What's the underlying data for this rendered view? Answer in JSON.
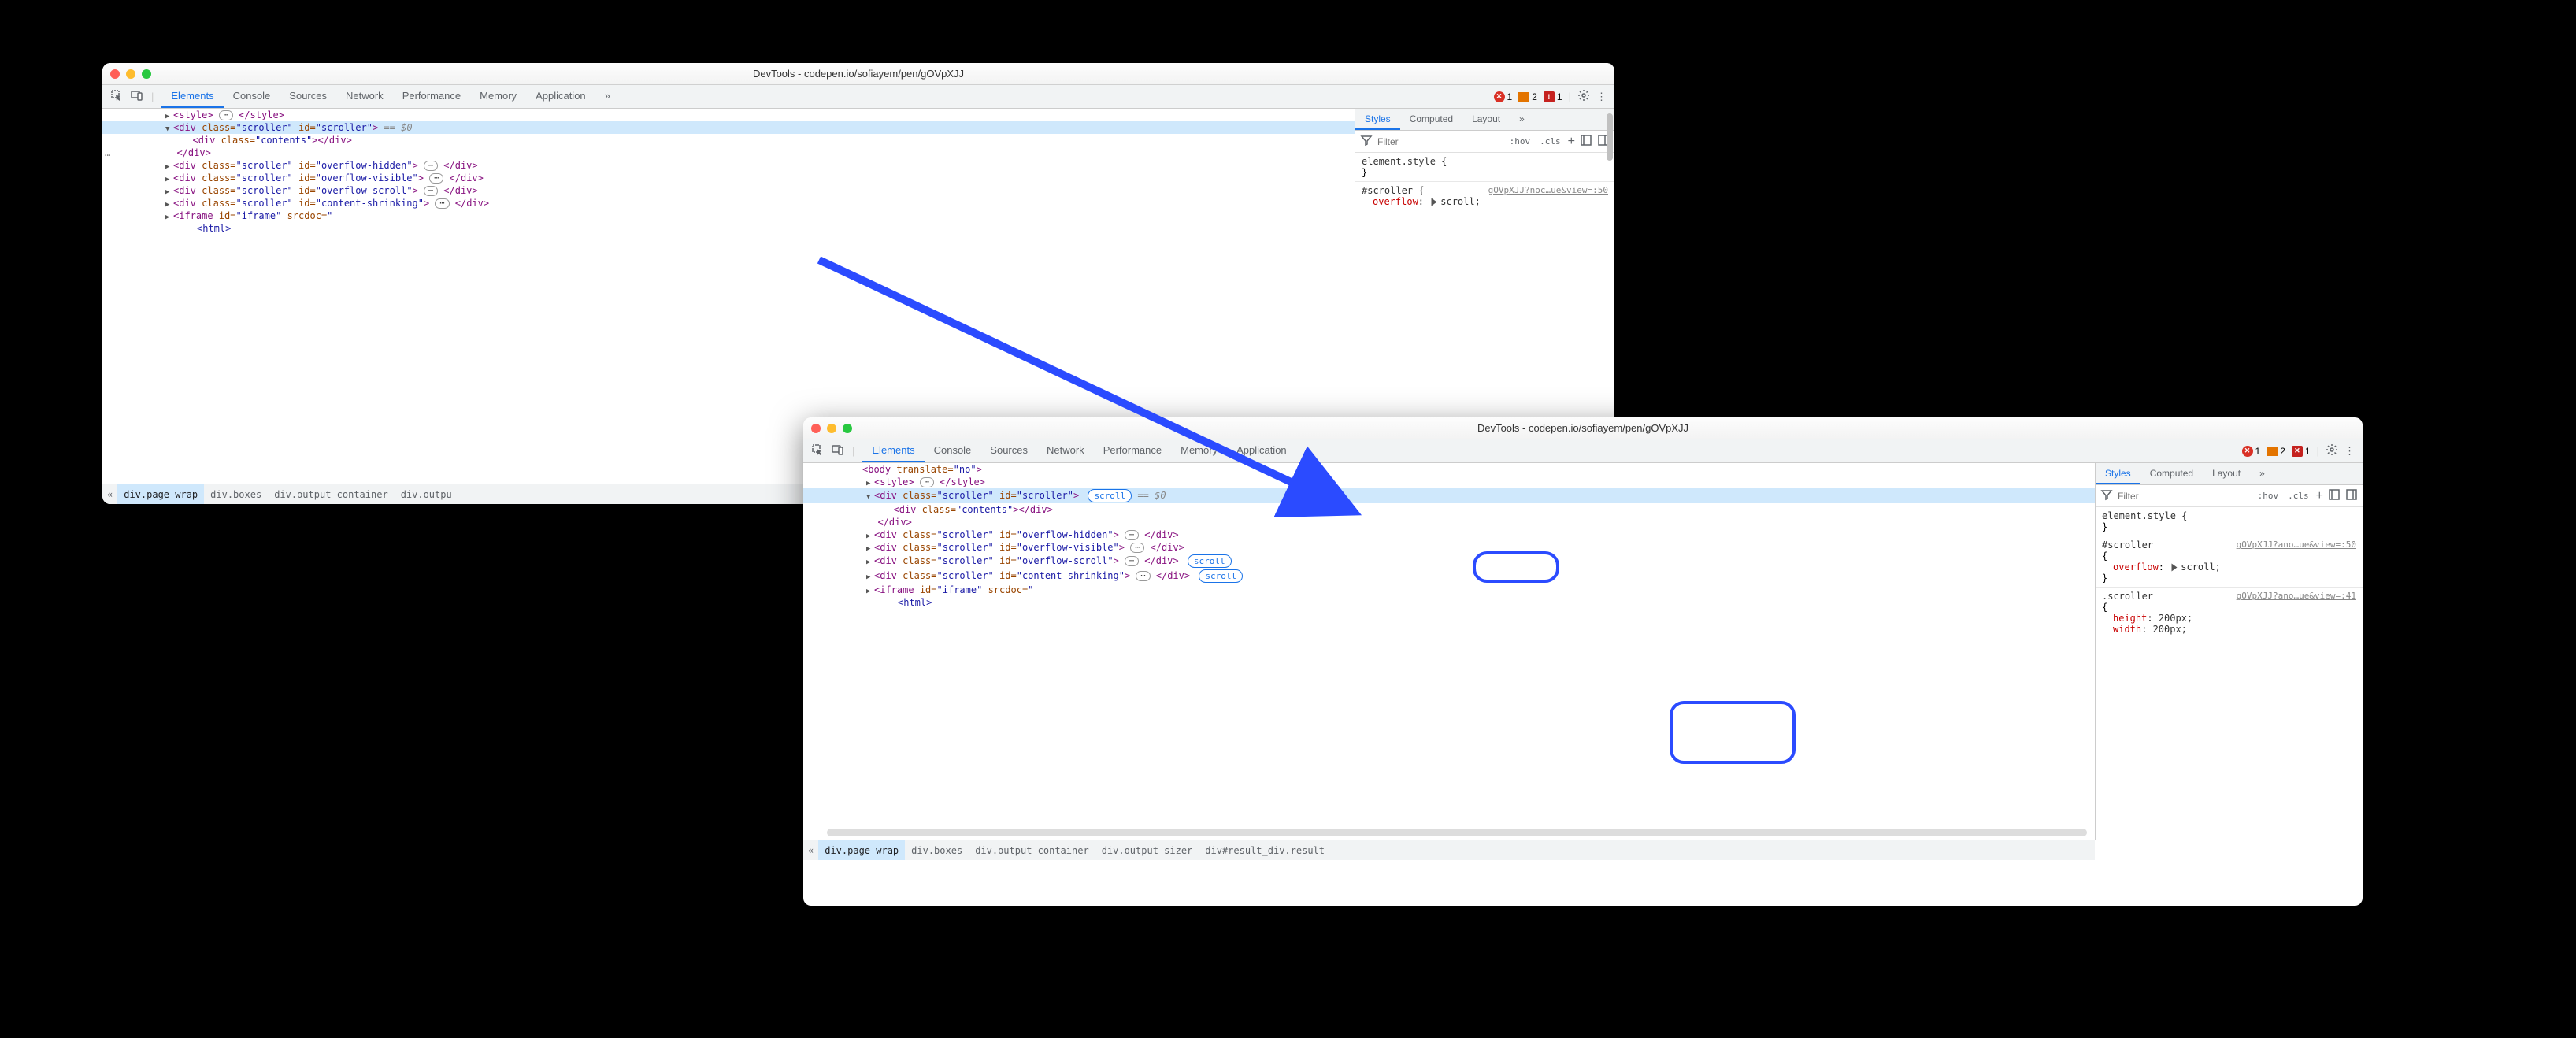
{
  "window1": {
    "title": "DevTools - codepen.io/sofiayem/pen/gOVpXJJ",
    "tabs": [
      "Elements",
      "Console",
      "Sources",
      "Network",
      "Performance",
      "Memory",
      "Application"
    ],
    "activeTab": "Elements",
    "badges": {
      "errors": "1",
      "warnings": "2",
      "issues": "1"
    },
    "sidebar": {
      "tabs": [
        "Styles",
        "Computed",
        "Layout"
      ],
      "active": "Styles",
      "filterPlaceholder": "Filter",
      "hov": ":hov",
      "cls": ".cls",
      "elementStyle": "element.style {",
      "closeBrace": "}",
      "rule1": {
        "selector": "#scroller {",
        "source": "gOVpXJJ?noc…ue&view=:50",
        "prop": "overflow",
        "value": "scroll;"
      }
    },
    "dom": {
      "styleOpen": "<style>",
      "styleClose": "</style>",
      "selectedTag": "div",
      "selectedClass": "scroller",
      "selectedId": "scroller",
      "eqVar": "== $0",
      "contentsTag": "div",
      "contentsClass": "contents",
      "closeDiv": "</div>",
      "rows": [
        {
          "class": "scroller",
          "id": "overflow-hidden"
        },
        {
          "class": "scroller",
          "id": "overflow-visible"
        },
        {
          "class": "scroller",
          "id": "overflow-scroll"
        },
        {
          "class": "scroller",
          "id": "content-shrinking"
        }
      ],
      "iframeOpen": "iframe",
      "iframeId": "iframe",
      "iframeSrcdoc": "srcdoc",
      "htmlTag": "<html>"
    },
    "breadcrumb": [
      "div.page-wrap",
      "div.boxes",
      "div.output-container",
      "div.outpu"
    ]
  },
  "window2": {
    "title": "DevTools - codepen.io/sofiayem/pen/gOVpXJJ",
    "tabs": [
      "Elements",
      "Console",
      "Sources",
      "Network",
      "Performance",
      "Memory",
      "Application"
    ],
    "activeTab": "Elements",
    "badges": {
      "errors": "1",
      "warnings": "2",
      "issues": "1"
    },
    "sidebar": {
      "tabs": [
        "Styles",
        "Computed",
        "Layout"
      ],
      "active": "Styles",
      "filterPlaceholder": "Filter",
      "hov": ":hov",
      "cls": ".cls",
      "elementStyle": "element.style {",
      "closeBrace": "}",
      "rule1": {
        "selector": "#scroller",
        "brace": "{",
        "source": "gOVpXJJ?ano…ue&view=:50",
        "prop": "overflow",
        "value": "scroll;"
      },
      "rule2": {
        "selector": ".scroller",
        "brace": "{",
        "source": "gOVpXJJ?ano…ue&view=:41",
        "prop1n": "height",
        "prop1v": "200px;",
        "prop2n": "width",
        "prop2v": "200px;"
      }
    },
    "dom": {
      "bodyFrag": "translate=\"no\">",
      "styleOpen": "<style>",
      "styleClose": "</style>",
      "selectedTag": "div",
      "selectedClass": "scroller",
      "selectedId": "scroller",
      "scrollBadge": "scroll",
      "eqVar": "== $0",
      "contentsTag": "div",
      "contentsClass": "contents",
      "closeDiv": "</div>",
      "rows": [
        {
          "class": "scroller",
          "id": "overflow-hidden",
          "badge": null
        },
        {
          "class": "scroller",
          "id": "overflow-visible",
          "badge": null
        },
        {
          "class": "scroller",
          "id": "overflow-scroll",
          "badge": "scroll"
        },
        {
          "class": "scroller",
          "id": "content-shrinking",
          "badge": "scroll"
        }
      ],
      "iframeOpen": "iframe",
      "iframeId": "iframe",
      "iframeSrcdoc": "srcdoc",
      "htmlTag": "<html>"
    },
    "breadcrumb": [
      "div.page-wrap",
      "div.boxes",
      "div.output-container",
      "div.output-sizer",
      "div#result_div.result"
    ]
  }
}
